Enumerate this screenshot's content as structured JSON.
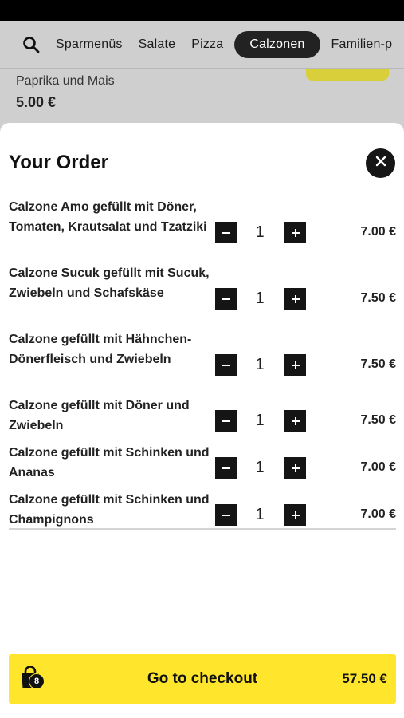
{
  "categories": [
    {
      "label": "Sparmenüs",
      "active": false
    },
    {
      "label": "Salate",
      "active": false
    },
    {
      "label": "Pizza",
      "active": false
    },
    {
      "label": "Calzonen",
      "active": true
    },
    {
      "label": "Familien-p",
      "active": false
    }
  ],
  "background_item": {
    "description": "Paprika und Mais",
    "price": "5.00 €"
  },
  "order": {
    "title": "Your Order",
    "items": [
      {
        "name": "Calzone Amo gefüllt mit Döner, Tomaten, Krautsalat und Tzatziki",
        "quantity": "1",
        "price": "7.00 €"
      },
      {
        "name": "Calzone Sucuk gefüllt mit Sucuk, Zwiebeln und Schafskäse",
        "quantity": "1",
        "price": "7.50 €"
      },
      {
        "name": "Calzone gefüllt mit Hähnchen-Dönerfleisch und Zwiebeln",
        "quantity": "1",
        "price": "7.50 €"
      },
      {
        "name": "Calzone gefüllt mit Döner und Zwiebeln",
        "quantity": "1",
        "price": "7.50 €"
      },
      {
        "name": "Calzone gefüllt mit Schinken und Ananas",
        "quantity": "1",
        "price": "7.00 €"
      },
      {
        "name": "Calzone gefüllt mit Schinken und Champignons",
        "quantity": "1",
        "price": "7.00 €"
      }
    ]
  },
  "checkout": {
    "label": "Go to checkout",
    "total": "57.50 €",
    "item_count": "8"
  },
  "icons": {
    "search": "search-icon",
    "close": "close-icon",
    "minus": "minus-icon",
    "plus": "plus-icon",
    "bag": "shopping-bag-icon"
  },
  "colors": {
    "accent": "#ffe62c",
    "dark": "#151515",
    "backdrop": "#cfcfcf"
  }
}
